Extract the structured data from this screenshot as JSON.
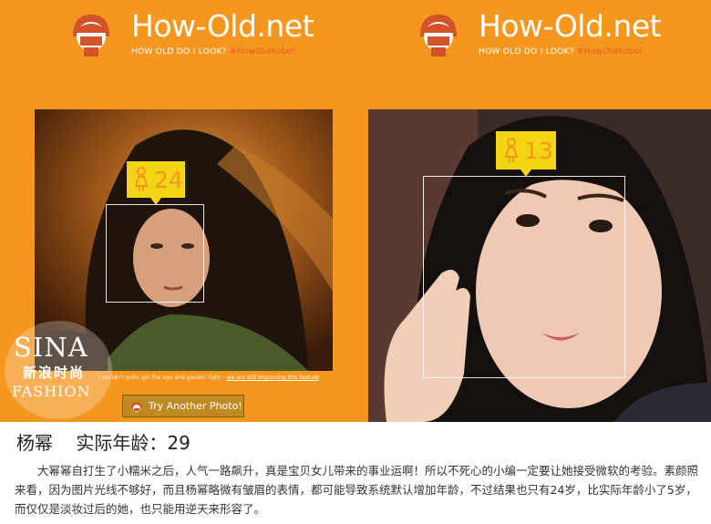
{
  "panels": [
    {
      "brand": "How-Old.net",
      "tagline": "HOW OLD DO I LOOK?",
      "hashtag": "#HowOldRobot",
      "age": "24",
      "notice_text": "I couldn't quite get the age and gender right – ",
      "notice_link": "we are still improving this feature",
      "button_label": "Try Another Photo!"
    },
    {
      "brand": "How-Old.net",
      "tagline": "HOW OLD DO I LOOK?",
      "hashtag": "#HowOldRobot",
      "age": "13"
    }
  ],
  "watermark": {
    "line1": "SINA",
    "line2": "新浪时尚",
    "line3": "FASHION"
  },
  "caption": {
    "title": "杨幂    实际年龄：29",
    "body": "大幂幂自打生了小糯米之后，人气一路飙升，真是宝贝女儿带来的事业运啊！所以不死心的小编一定要让她接受微软的考验。素颜照来看，因为图片光线不够好，而且杨幂略微有皱眉的表情，都可能导致系统默认增加年龄，不过结果也只有24岁，比实际年龄小了5岁，而仅仅是淡妆过后的她，也只能用逆天来形容了。"
  },
  "colors": {
    "background": "#f5961f",
    "tag": "#f2d616",
    "hashtag": "#f05a22"
  }
}
